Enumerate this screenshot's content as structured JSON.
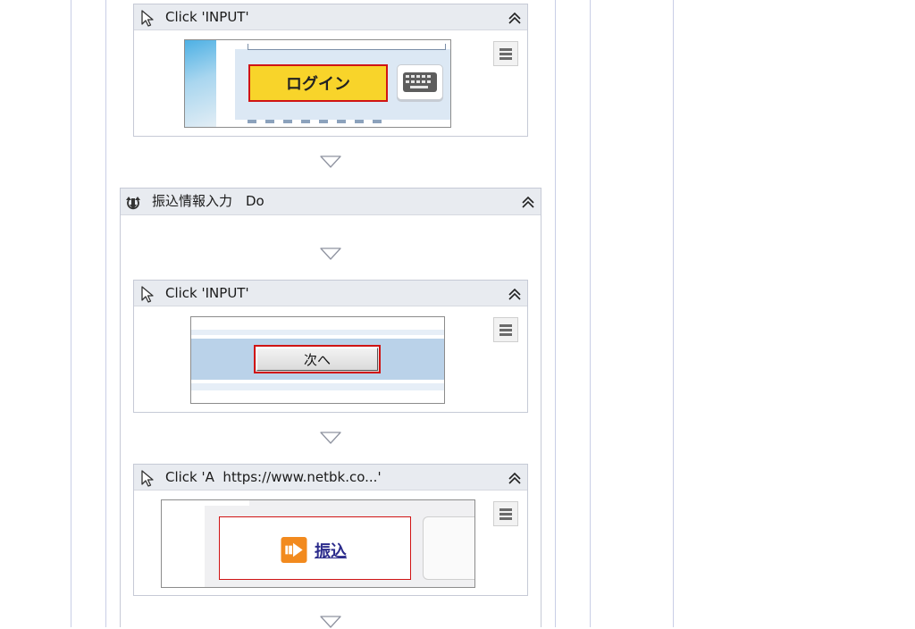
{
  "steps": {
    "click_input_1": {
      "title": "Click 'INPUT'",
      "button_text": "ログイン"
    },
    "do_block": {
      "title": "振込情報入力　Do"
    },
    "click_input_2": {
      "title": "Click 'INPUT'",
      "button_text": "次へ"
    },
    "click_a": {
      "title": "Click 'A  https://www.netbk.co...'",
      "link_text": "振込"
    }
  },
  "colors": {
    "header_bg": "#e8ebf0",
    "border": "#c6cad6",
    "highlight": "#d01414",
    "login_yellow": "#f8d42a",
    "link_blue": "#2c2c8c",
    "transfer_orange": "#f28a1e"
  }
}
